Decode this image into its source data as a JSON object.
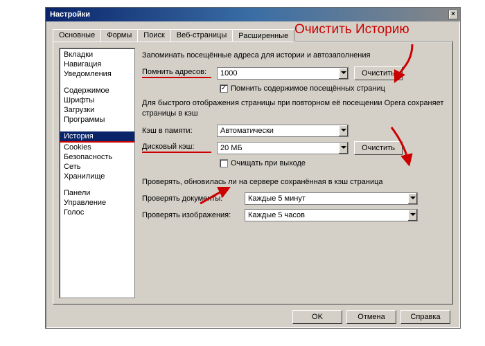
{
  "window": {
    "title": "Настройки",
    "close_label": "×"
  },
  "annotation": {
    "text": "Очистить Историю"
  },
  "tabs": [
    {
      "label": "Основные"
    },
    {
      "label": "Формы"
    },
    {
      "label": "Поиск"
    },
    {
      "label": "Веб-страницы"
    },
    {
      "label": "Расширенные",
      "active": true
    }
  ],
  "sidebar": {
    "groups": [
      [
        {
          "label": "Вкладки"
        },
        {
          "label": "Навигация"
        },
        {
          "label": "Уведомления"
        }
      ],
      [
        {
          "label": "Содержимое"
        },
        {
          "label": "Шрифты"
        },
        {
          "label": "Загрузки"
        },
        {
          "label": "Программы"
        }
      ],
      [
        {
          "label": "История",
          "selected": true
        },
        {
          "label": "Cookies"
        },
        {
          "label": "Безопасность"
        },
        {
          "label": "Сеть"
        },
        {
          "label": "Хранилище"
        }
      ],
      [
        {
          "label": "Панели"
        },
        {
          "label": "Управление"
        },
        {
          "label": "Голос"
        }
      ]
    ]
  },
  "content": {
    "intro": "Запоминать посещённые адреса для истории и автозаполнения",
    "address_label": "Помнить адресов:",
    "address_value": "1000",
    "clear_history_btn": "Очистить",
    "remember_content_label": "Помнить содержимое посещённых страниц",
    "remember_content_checked": "✓",
    "cache_explain": "Для быстрого отображения страницы при повторном её посещении Opera сохраняет страницы в кэш",
    "mem_cache_label": "Кэш в памяти:",
    "mem_cache_value": "Автоматически",
    "disk_cache_label": "Дисковый кэш:",
    "disk_cache_value": "20 МБ",
    "clear_cache_btn": "Очистить",
    "clear_on_exit_label": "Очищать при выходе",
    "check_intro": "Проверять, обновилась ли на сервере сохранённая в кэш страница",
    "check_docs_label": "Проверять документы:",
    "check_docs_value": "Каждые 5 минут",
    "check_imgs_label": "Проверять изображения:",
    "check_imgs_value": "Каждые 5 часов"
  },
  "buttons": {
    "ok": "OK",
    "cancel": "Отмена",
    "help": "Справка"
  }
}
